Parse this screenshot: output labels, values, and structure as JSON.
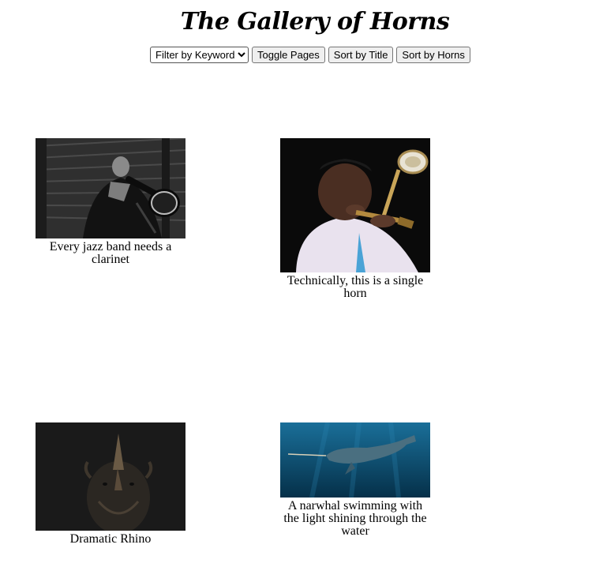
{
  "header": {
    "title": "The Gallery of Horns"
  },
  "controls": {
    "filter_selected": "Filter by Keyword",
    "toggle_label": "Toggle Pages",
    "sort_title_label": "Sort by Title",
    "sort_horns_label": "Sort by Horns"
  },
  "gallery": {
    "items": [
      {
        "caption": "Every jazz band needs a clarinet"
      },
      {
        "caption": "Technically, this is a single horn"
      },
      {
        "caption": "Dramatic Rhino"
      },
      {
        "caption": "A narwhal swimming with the light shining through the water"
      }
    ]
  }
}
